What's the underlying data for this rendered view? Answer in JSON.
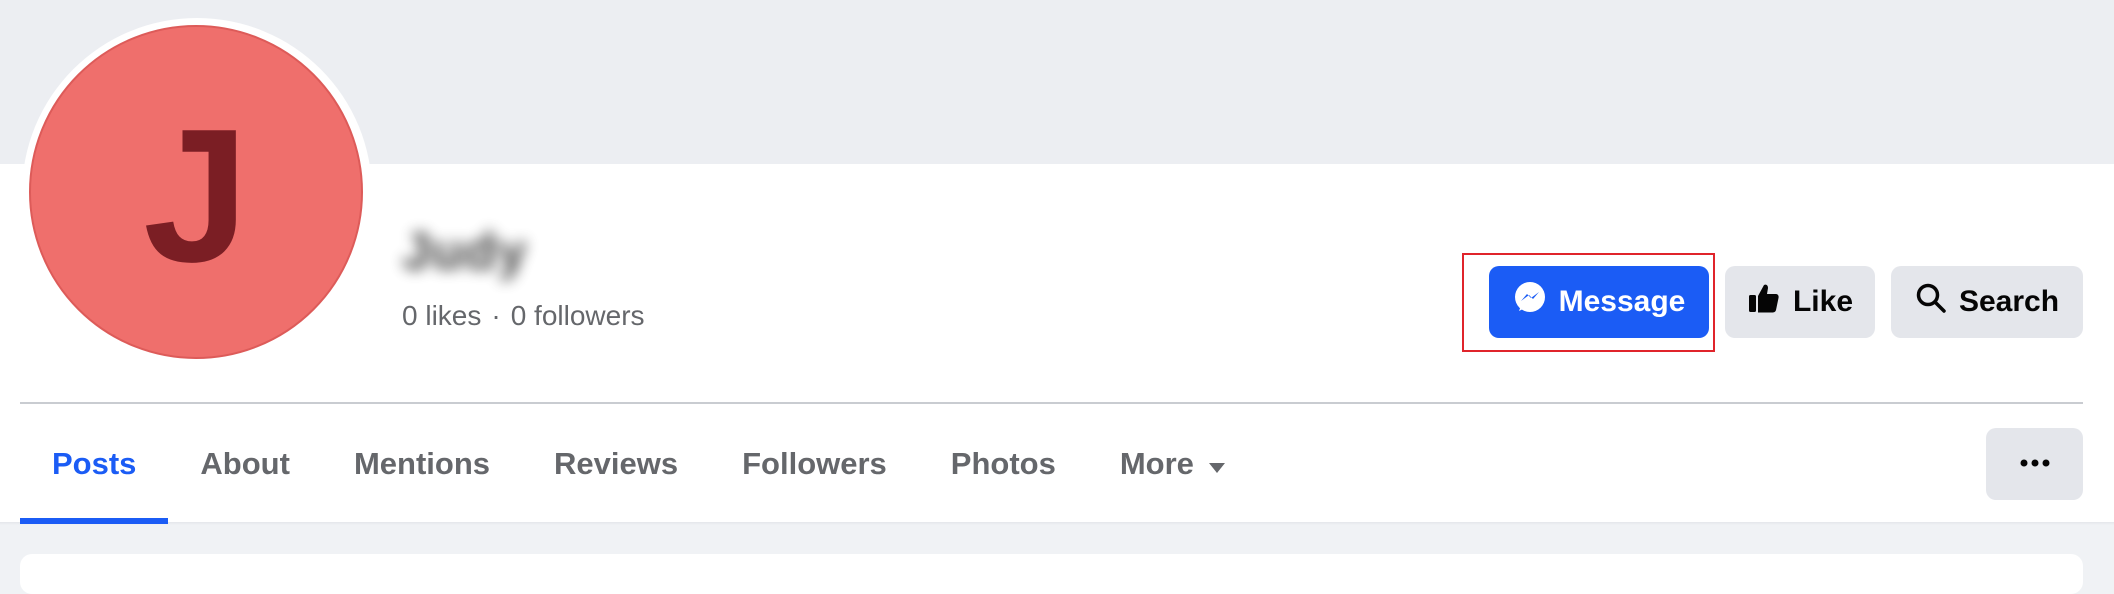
{
  "profile": {
    "avatar_letter": "J",
    "name": "Judy",
    "stats": {
      "likes": "0 likes",
      "separator": "·",
      "followers": "0 followers"
    }
  },
  "actions": {
    "message_label": "Message",
    "like_label": "Like",
    "search_label": "Search"
  },
  "tabs": [
    {
      "label": "Posts",
      "active": true
    },
    {
      "label": "About"
    },
    {
      "label": "Mentions"
    },
    {
      "label": "Reviews"
    },
    {
      "label": "Followers"
    },
    {
      "label": "Photos"
    },
    {
      "label": "More"
    }
  ],
  "icons": {
    "message": "messenger-icon",
    "like": "thumbs-up-icon",
    "search": "search-icon",
    "more": "caret-down-icon",
    "options": "ellipsis-icon"
  },
  "colors": {
    "accent": "#1b5cf5",
    "avatar_bg": "#ef6f6c",
    "avatar_letter": "#7b1e24",
    "highlight": "#e0242b"
  }
}
